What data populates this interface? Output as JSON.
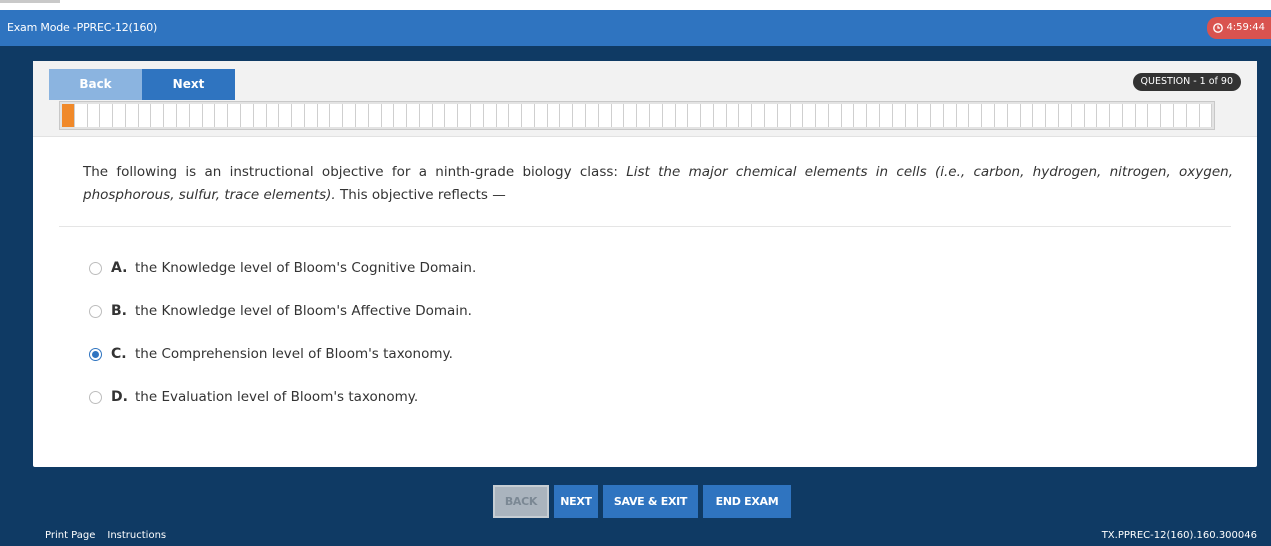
{
  "window": {
    "title": "Exam Mode -PPREC-12(160)",
    "timer": "4:59:44"
  },
  "nav": {
    "back_label": "Back",
    "next_label": "Next",
    "question_badge": "QUESTION - 1 of 90",
    "progress_total": 90,
    "progress_current": 1
  },
  "question": {
    "intro": "The following is an instructional objective for a ninth-grade biology class: ",
    "objective": "List the major chemical elements in cells (i.e., carbon, hydrogen, nitrogen, oxygen, phosphorous, sulfur, trace elements).",
    "tail": " This objective reflects —"
  },
  "options": [
    {
      "letter": "A.",
      "text": "the Knowledge level of Bloom's Cognitive Domain.",
      "selected": false
    },
    {
      "letter": "B.",
      "text": "the Knowledge level of Bloom's Affective Domain.",
      "selected": false
    },
    {
      "letter": "C.",
      "text": "the Comprehension level of Bloom's taxonomy.",
      "selected": true
    },
    {
      "letter": "D.",
      "text": "the Evaluation level of Bloom's taxonomy.",
      "selected": false
    }
  ],
  "actions": {
    "back": "BACK",
    "next": "NEXT",
    "save_exit": "SAVE & EXIT",
    "end_exam": "END EXAM"
  },
  "footer": {
    "print_page": "Print Page",
    "instructions": "Instructions",
    "exam_code": "TX.PPREC-12(160).160.300046"
  },
  "colors": {
    "header_blue": "#2f74c0",
    "background_navy": "#0f3a64",
    "timer_red": "#d9534f",
    "progress_current": "#f0892a"
  },
  "icons": {
    "timer": "clock-icon"
  }
}
